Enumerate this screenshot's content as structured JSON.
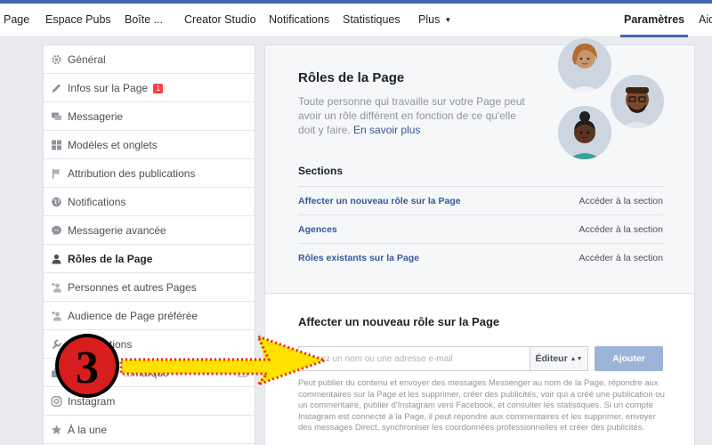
{
  "tabs": [
    "Page",
    "Espace Pubs",
    "Boîte ...",
    "Creator Studio",
    "Notifications",
    "Statistiques",
    "Plus",
    "Paramètres",
    "Aide"
  ],
  "sidebar": {
    "items": [
      {
        "label": "Général",
        "icon": "gear-icon"
      },
      {
        "label": "Infos sur la Page",
        "icon": "pencil-icon",
        "badge": "1"
      },
      {
        "label": "Messagerie",
        "icon": "chat-bubbles-icon"
      },
      {
        "label": "Modèles et onglets",
        "icon": "grid-icon"
      },
      {
        "label": "Attribution des publications",
        "icon": "flag-icon"
      },
      {
        "label": "Notifications",
        "icon": "globe-icon"
      },
      {
        "label": "Messagerie avancée",
        "icon": "messenger-icon"
      },
      {
        "label": "Rôles de la Page",
        "icon": "person-icon"
      },
      {
        "label": "Personnes et autres Pages",
        "icon": "person-add-icon"
      },
      {
        "label": "Audience de Page préférée",
        "icon": "person-add-icon"
      },
      {
        "label": "...tions",
        "icon": "wrench-icon"
      },
      {
        "label": "...marque",
        "icon": "briefcase-icon"
      },
      {
        "label": "Instagram",
        "icon": "instagram-icon"
      },
      {
        "label": "À la une",
        "icon": "star-icon"
      }
    ]
  },
  "roles": {
    "title": "Rôles de la Page",
    "description": "Toute personne qui travaille sur votre Page peut avoir un rôle différent en fonction de ce qu'elle doit y faire.",
    "learn_more": "En savoir plus",
    "sections_label": "Sections",
    "sections": [
      {
        "label": "Affecter un nouveau rôle sur la Page",
        "action": "Accéder à la section"
      },
      {
        "label": "Agences",
        "action": "Accéder à la section"
      },
      {
        "label": "Rôles existants sur la Page",
        "action": "Accéder à la section"
      }
    ]
  },
  "assign": {
    "title": "Affecter un nouveau rôle sur la Page",
    "placeholder": "...ssez un nom ou une adresse e-mail",
    "role": "Éditeur",
    "add_button": "Ajouter",
    "help": "Peut publier du contenu et envoyer des messages Messenger au nom de la Page, répondre aux commentaires sur la Page et les supprimer, créer des publicités, voir qui a créé une publication ou un commentaire, publier d'Instagram vers Facebook, et consulter les statistiques. Si un compte Instagram est connecté à la Page, il peut répondre aux commentaires et les supprimer, envoyer des messages Direct, synchroniser les coordonnées professionnelles et créer des publicités."
  },
  "annotation": {
    "number": "3"
  },
  "colors": {
    "brand": "#4267b2",
    "link": "#365899",
    "button": "#9cb4d8",
    "badge": "#fa3e3e",
    "arrow_fill": "#ffe100",
    "arrow_dots": "#e8261e"
  }
}
